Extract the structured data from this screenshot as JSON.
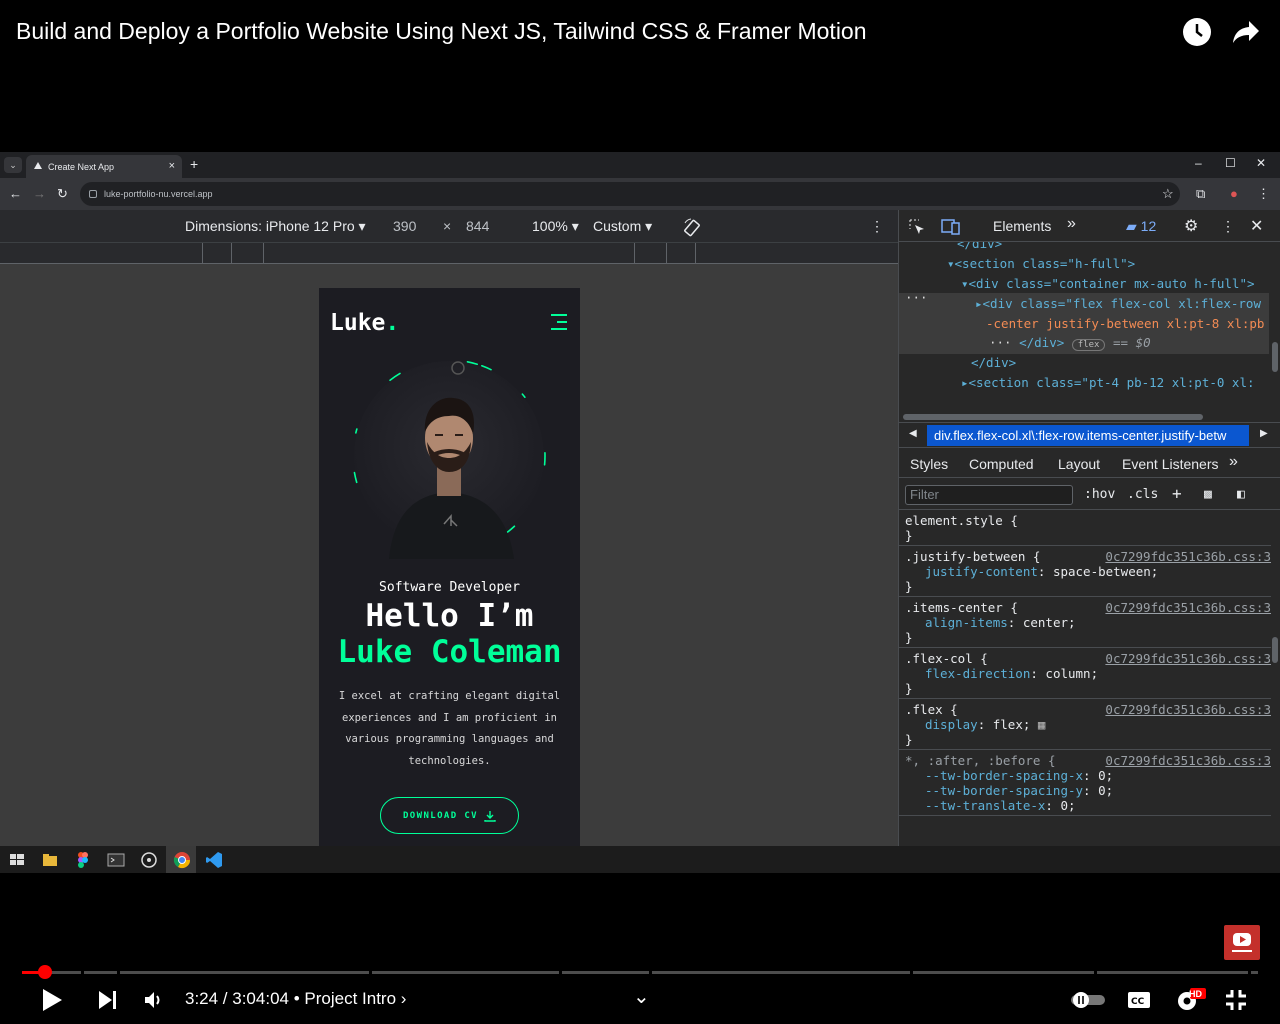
{
  "video": {
    "title": "Build and Deploy a Portfolio Website Using Next JS, Tailwind CSS & Framer Motion",
    "time": "3:24 / 3:04:04",
    "chapter": "• Project Intro",
    "chapter_chevron": "›",
    "expand_chevron": "⌄",
    "progress_fraction": 0.0184,
    "hd_badge": "HD"
  },
  "browser": {
    "tab_title": "Create Next App",
    "tab_close": "×",
    "new_tab": "+",
    "url": "luke-portfolio-nu.vercel.app",
    "tab_dropdown": "⌄",
    "minimize": "–",
    "maximize": "☐",
    "close": "✕"
  },
  "device_toolbar": {
    "dimensions": "Dimensions: iPhone 12 Pro ▾",
    "width": "390",
    "times": "×",
    "height": "844",
    "zoom": "100% ▾",
    "throttle": "Custom ▾",
    "more": "⋮"
  },
  "site": {
    "logo": "Luke",
    "logo_dot": ".",
    "subtitle": "Software Developer",
    "hello": "Hello I’m",
    "name": "Luke Coleman",
    "description": "I excel at crafting elegant digital experiences and I am proficient in various programming languages and technologies.",
    "cta": "DOWNLOAD CV",
    "accent": "#00ff99",
    "background": "#1c1c22"
  },
  "devtools": {
    "elements_tab": "Elements",
    "more_tabs": "»",
    "issues_count": "12",
    "dom": {
      "line1": "</div>",
      "line2": "<section class=\"h-full\">",
      "line3": "<div class=\"container mx-auto h-full\">",
      "line4": "<div class=\"flex flex-col xl:flex-row",
      "line5": "-center justify-between xl:pt-8 xl:pb",
      "line6_close": "</div>",
      "line6_badge": "flex",
      "line6_eq": "== $0",
      "line7": "</div>",
      "line8": "<section class=\"pt-4 pb-12 xl:pt-0 xl:",
      "ellipsis": "···"
    },
    "breadcrumb": "div.flex.flex-col.xl\\:flex-row.items-center.justify-betw",
    "pane_tabs": [
      "Styles",
      "Computed",
      "Layout",
      "Event Listeners",
      "»"
    ],
    "filter_placeholder": "Filter",
    "hov": ":hov",
    "cls": ".cls",
    "rules": [
      {
        "selector": "element.style {",
        "src": "",
        "decls": [],
        "close": "}"
      },
      {
        "selector": ".justify-between {",
        "src": "0c7299fdc351c36b.css:3",
        "decls": [
          {
            "prop": "justify-content",
            "value": "space-between;"
          }
        ],
        "close": "}"
      },
      {
        "selector": ".items-center {",
        "src": "0c7299fdc351c36b.css:3",
        "decls": [
          {
            "prop": "align-items",
            "value": "center;"
          }
        ],
        "close": "}"
      },
      {
        "selector": ".flex-col {",
        "src": "0c7299fdc351c36b.css:3",
        "decls": [
          {
            "prop": "flex-direction",
            "value": "column;"
          }
        ],
        "close": "}"
      },
      {
        "selector": ".flex {",
        "src": "0c7299fdc351c36b.css:3",
        "decls": [
          {
            "prop": "display",
            "value": "flex;"
          }
        ],
        "close": "}"
      },
      {
        "selector": "*, :after, :before {",
        "src": "0c7299fdc351c36b.css:3",
        "decls": [
          {
            "prop": "--tw-border-spacing-x",
            "value": "0;"
          },
          {
            "prop": "--tw-border-spacing-y",
            "value": "0;"
          },
          {
            "prop": "--tw-translate-x",
            "value": "0;"
          }
        ],
        "close": ""
      }
    ]
  }
}
